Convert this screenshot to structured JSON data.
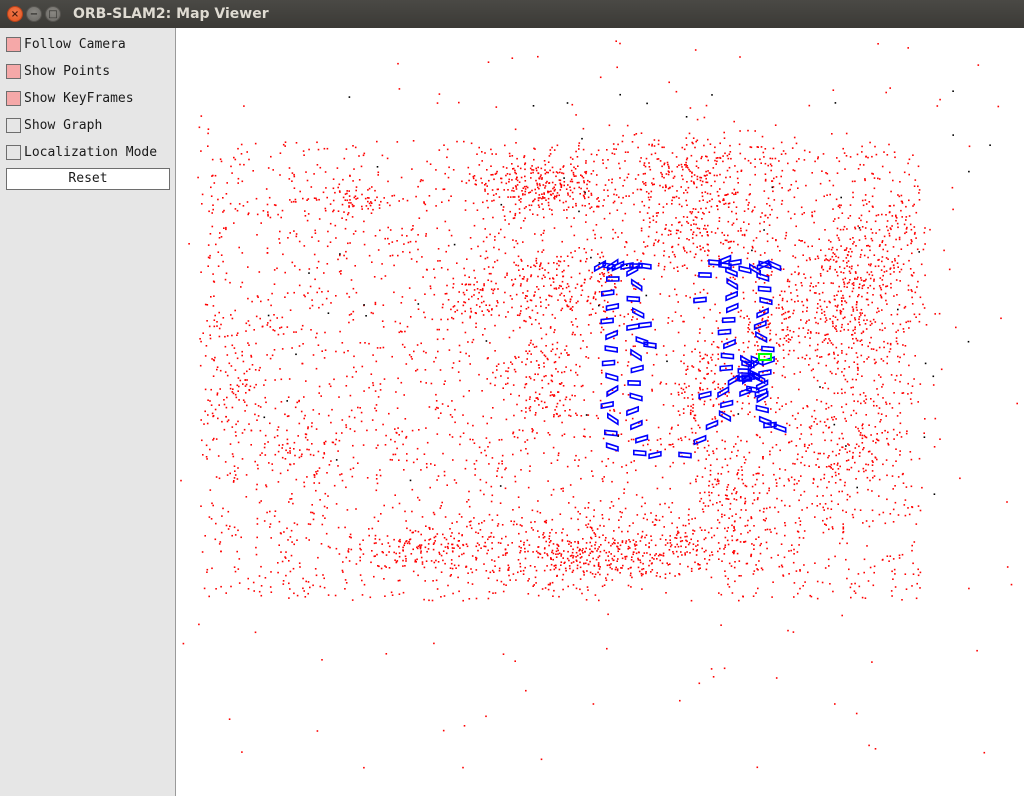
{
  "window": {
    "title": "ORB-SLAM2: Map Viewer",
    "controls": {
      "close": "×",
      "minimize": "−",
      "maximize": "□"
    }
  },
  "panel": {
    "checkboxes": [
      {
        "label": "Follow Camera",
        "checked": true
      },
      {
        "label": "Show Points",
        "checked": true
      },
      {
        "label": "Show KeyFrames",
        "checked": true
      },
      {
        "label": "Show Graph",
        "checked": false
      },
      {
        "label": "Localization Mode",
        "checked": false
      }
    ],
    "reset_label": "Reset"
  },
  "colors": {
    "map_point": "#ff0000",
    "reference_point": "#000000",
    "keyframe": "#0000ff",
    "current_camera": "#00ff00",
    "panel_bg": "#e6e6e6",
    "checked_fill": "#f5a8a8"
  },
  "icons": [
    "close-icon",
    "minimize-icon",
    "maximize-icon"
  ]
}
